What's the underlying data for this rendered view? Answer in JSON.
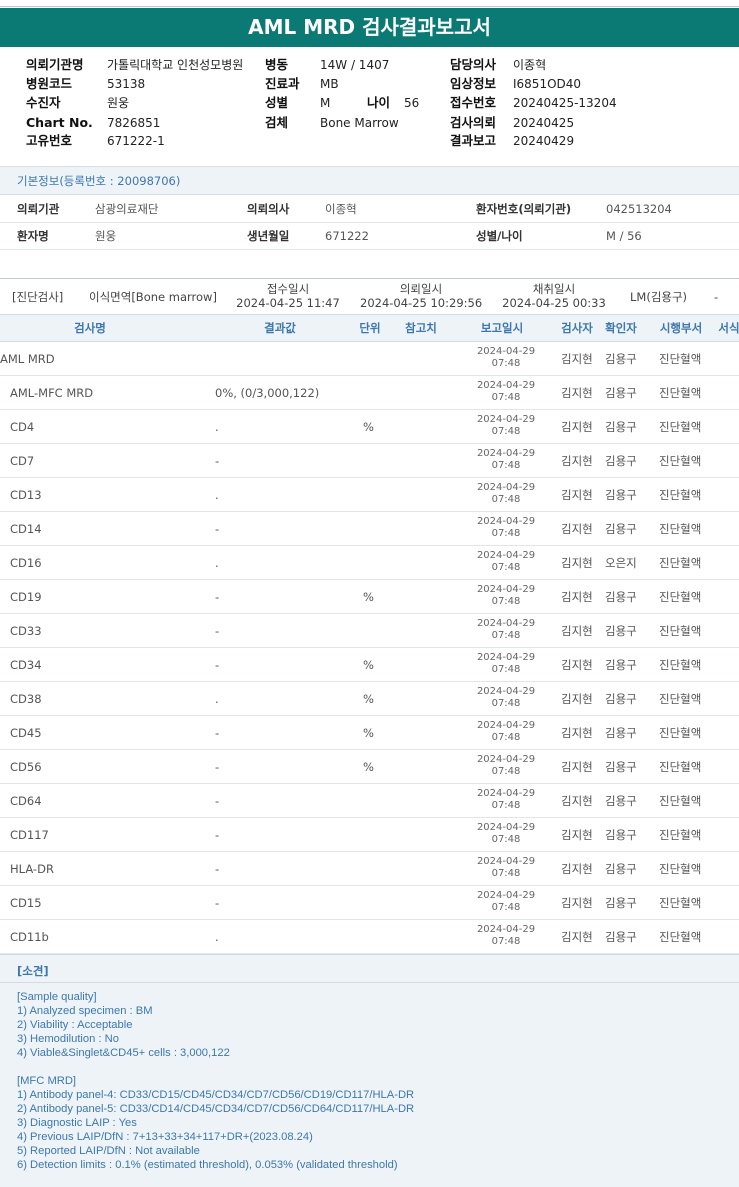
{
  "title": "AML MRD 검사결과보고서",
  "header": [
    {
      "label": "의뢰기관명",
      "value": "가톨릭대학교 인천성모병원",
      "col": 0,
      "row": 0
    },
    {
      "label": "병원코드",
      "value": "53138",
      "col": 0,
      "row": 1
    },
    {
      "label": "수진자",
      "value": "원웅",
      "col": 0,
      "row": 2
    },
    {
      "label": "Chart No.",
      "value": "7826851",
      "col": 0,
      "row": 3
    },
    {
      "label": "고유번호",
      "value": "671222-1",
      "col": 0,
      "row": 4
    },
    {
      "label": "병동",
      "value": "14W / 1407",
      "col": 1,
      "row": 0
    },
    {
      "label": "진료과",
      "value": "MB",
      "col": 1,
      "row": 1
    },
    {
      "label": "성별",
      "value": "M",
      "col": 1,
      "row": 2
    },
    {
      "label": "검체",
      "value": "Bone Marrow",
      "col": 1,
      "row": 3
    },
    {
      "label": "담당의사",
      "value": "이종혁",
      "col": 2,
      "row": 0
    },
    {
      "label": "임상정보",
      "value": "I6851OD40",
      "col": 2,
      "row": 1
    },
    {
      "label": "접수번호",
      "value": "20240425-13204",
      "col": 2,
      "row": 2
    },
    {
      "label": "검사의뢰",
      "value": "20240425",
      "col": 2,
      "row": 3
    },
    {
      "label": "결과보고",
      "value": "20240429",
      "col": 2,
      "row": 4
    }
  ],
  "header_age": {
    "label": "나이",
    "value": "56"
  },
  "basic": {
    "title": "기본정보(등록번호 : 20098706)",
    "rows": [
      [
        {
          "label": "의뢰기관",
          "value": "삼광의료재단"
        },
        {
          "label": "의뢰의사",
          "value": "이종혁"
        },
        {
          "label": "환자번호(의뢰기관)",
          "value": "042513204"
        }
      ],
      [
        {
          "label": "환자명",
          "value": "원웅"
        },
        {
          "label": "생년월일",
          "value": "671222"
        },
        {
          "label": "성별/나이",
          "value": "M / 56"
        }
      ]
    ]
  },
  "order": {
    "dept": "[진단검사]",
    "specimen": "이식면역[Bone marrow]",
    "received_label": "접수일시",
    "received": "2024-04-25 11:47",
    "requested_label": "의뢰일시",
    "requested": "2024-04-25 10:29:56",
    "collected_label": "채취일시",
    "collected": "2024-04-25 00:33",
    "lab": "LM(김용구)",
    "extra": "-"
  },
  "columns": [
    "검사명",
    "결과값",
    "단위",
    "참고치",
    "보고일시",
    "검사자",
    "확인자",
    "시행부서",
    "서식"
  ],
  "results": [
    {
      "name": "AML MRD",
      "value": "",
      "unit": "",
      "ref": "",
      "date": "2024-04-29",
      "time": "07:48",
      "tester": "김지현",
      "confirmer": "김용구",
      "dept": "진단혈액",
      "indent": false
    },
    {
      "name": "AML-MFC MRD",
      "value": "0%, (0/3,000,122)",
      "unit": "",
      "ref": "",
      "date": "2024-04-29",
      "time": "07:48",
      "tester": "김지현",
      "confirmer": "김용구",
      "dept": "진단혈액",
      "indent": true
    },
    {
      "name": "CD4",
      "value": ".",
      "unit": "%",
      "ref": "",
      "date": "2024-04-29",
      "time": "07:48",
      "tester": "김지현",
      "confirmer": "김용구",
      "dept": "진단혈액",
      "indent": true
    },
    {
      "name": "CD7",
      "value": "-",
      "unit": "",
      "ref": "",
      "date": "2024-04-29",
      "time": "07:48",
      "tester": "김지현",
      "confirmer": "김용구",
      "dept": "진단혈액",
      "indent": true
    },
    {
      "name": "CD13",
      "value": ".",
      "unit": "",
      "ref": "",
      "date": "2024-04-29",
      "time": "07:48",
      "tester": "김지현",
      "confirmer": "김용구",
      "dept": "진단혈액",
      "indent": true
    },
    {
      "name": "CD14",
      "value": "-",
      "unit": "",
      "ref": "",
      "date": "2024-04-29",
      "time": "07:48",
      "tester": "김지현",
      "confirmer": "김용구",
      "dept": "진단혈액",
      "indent": true
    },
    {
      "name": "CD16",
      "value": ".",
      "unit": "",
      "ref": "",
      "date": "2024-04-29",
      "time": "07:48",
      "tester": "김지현",
      "confirmer": "오은지",
      "dept": "진단혈액",
      "indent": true
    },
    {
      "name": "CD19",
      "value": "-",
      "unit": "%",
      "ref": "",
      "date": "2024-04-29",
      "time": "07:48",
      "tester": "김지현",
      "confirmer": "김용구",
      "dept": "진단혈액",
      "indent": true
    },
    {
      "name": "CD33",
      "value": "-",
      "unit": "",
      "ref": "",
      "date": "2024-04-29",
      "time": "07:48",
      "tester": "김지현",
      "confirmer": "김용구",
      "dept": "진단혈액",
      "indent": true
    },
    {
      "name": "CD34",
      "value": "-",
      "unit": "%",
      "ref": "",
      "date": "2024-04-29",
      "time": "07:48",
      "tester": "김지현",
      "confirmer": "김용구",
      "dept": "진단혈액",
      "indent": true
    },
    {
      "name": "CD38",
      "value": ".",
      "unit": "%",
      "ref": "",
      "date": "2024-04-29",
      "time": "07:48",
      "tester": "김지현",
      "confirmer": "김용구",
      "dept": "진단혈액",
      "indent": true
    },
    {
      "name": "CD45",
      "value": "-",
      "unit": "%",
      "ref": "",
      "date": "2024-04-29",
      "time": "07:48",
      "tester": "김지현",
      "confirmer": "김용구",
      "dept": "진단혈액",
      "indent": true
    },
    {
      "name": "CD56",
      "value": "-",
      "unit": "%",
      "ref": "",
      "date": "2024-04-29",
      "time": "07:48",
      "tester": "김지현",
      "confirmer": "김용구",
      "dept": "진단혈액",
      "indent": true
    },
    {
      "name": "CD64",
      "value": "-",
      "unit": "",
      "ref": "",
      "date": "2024-04-29",
      "time": "07:48",
      "tester": "김지현",
      "confirmer": "김용구",
      "dept": "진단혈액",
      "indent": true
    },
    {
      "name": "CD117",
      "value": "-",
      "unit": "",
      "ref": "",
      "date": "2024-04-29",
      "time": "07:48",
      "tester": "김지현",
      "confirmer": "김용구",
      "dept": "진단혈액",
      "indent": true
    },
    {
      "name": "HLA-DR",
      "value": "-",
      "unit": "",
      "ref": "",
      "date": "2024-04-29",
      "time": "07:48",
      "tester": "김지현",
      "confirmer": "김용구",
      "dept": "진단혈액",
      "indent": true
    },
    {
      "name": "CD15",
      "value": "-",
      "unit": "",
      "ref": "",
      "date": "2024-04-29",
      "time": "07:48",
      "tester": "김지현",
      "confirmer": "김용구",
      "dept": "진단혈액",
      "indent": true
    },
    {
      "name": "CD11b",
      "value": ".",
      "unit": "",
      "ref": "",
      "date": "2024-04-29",
      "time": "07:48",
      "tester": "김지현",
      "confirmer": "김용구",
      "dept": "진단혈액",
      "indent": true
    }
  ],
  "findings": {
    "title": "[소견]",
    "lines": [
      "[Sample quality]",
      "1) Analyzed specimen : BM",
      "2) Viability : Acceptable",
      "3) Hemodilution : No",
      "4) Viable&Singlet&CD45+ cells : 3,000,122",
      "",
      "[MFC MRD]",
      "1) Antibody panel-4: CD33/CD15/CD45/CD34/CD7/CD56/CD19/CD117/HLA-DR",
      "2) Antibody panel-5: CD33/CD14/CD45/CD34/CD7/CD56/CD64/CD117/HLA-DR",
      "3) Diagnostic LAIP : Yes",
      "4) Previous LAIP/DfN : 7+13+33+34+117+DR+(2023.08.24)",
      "5) Reported LAIP/DfN : Not available",
      "6) Detection limits : 0.1% (estimated threshold), 0.053% (validated threshold)"
    ]
  },
  "colors": {
    "title_bg": "#0b7a74",
    "accent_text": "#3c78ae",
    "header_bg": "#eef3f7"
  }
}
